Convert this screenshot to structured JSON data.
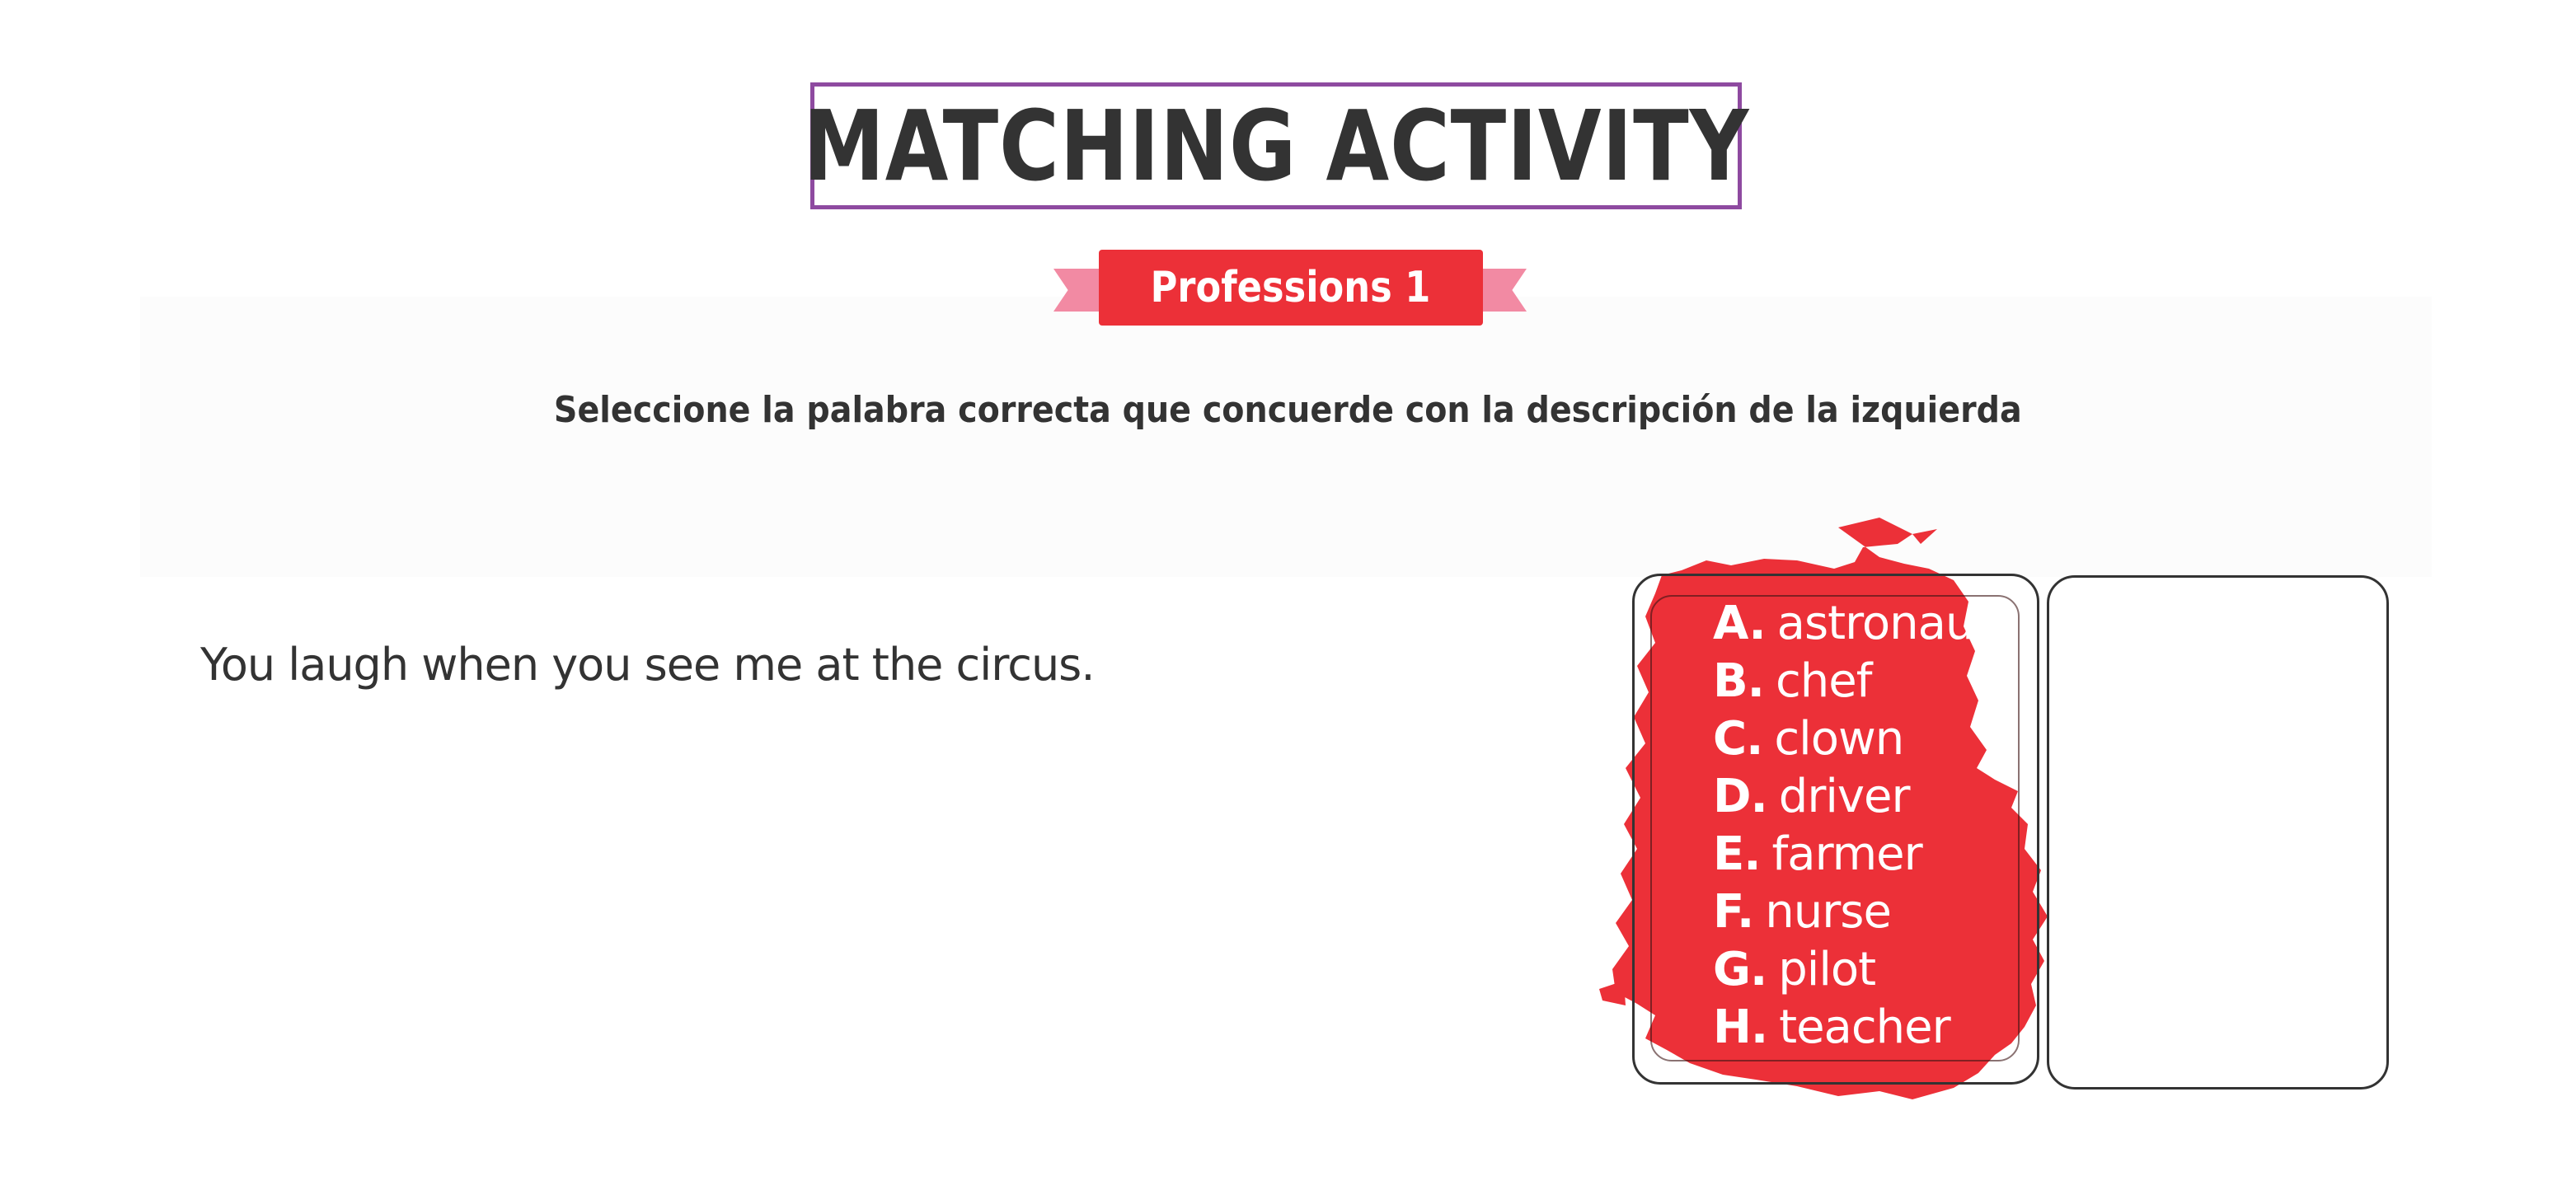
{
  "header": {
    "title": "MATCHING ACTIVITY",
    "subtitle": "Professions 1"
  },
  "instruction": "Seleccione la palabra correcta que concuerde con la descripción de la izquierda",
  "question": {
    "text": "You laugh when you see me at the circus."
  },
  "options": [
    {
      "letter": "A.",
      "word": "astronaut"
    },
    {
      "letter": "B.",
      "word": "chef"
    },
    {
      "letter": "C.",
      "word": "clown"
    },
    {
      "letter": "D.",
      "word": "driver"
    },
    {
      "letter": "E.",
      "word": "farmer"
    },
    {
      "letter": "F.",
      "word": "nurse"
    },
    {
      "letter": "G.",
      "word": "pilot"
    },
    {
      "letter": "H.",
      "word": "teacher"
    }
  ],
  "colors": {
    "accent_red": "#ec3038",
    "ribbon_pink": "#f28aa3",
    "title_border": "#8e4aa0",
    "text_dark": "#333333"
  }
}
